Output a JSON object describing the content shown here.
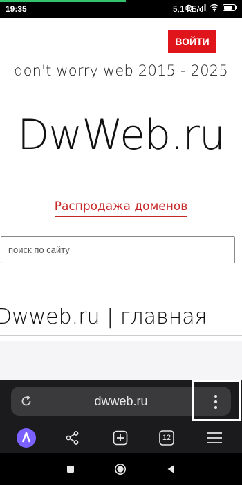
{
  "status_bar": {
    "time": "19:35",
    "network_speed": "5,1 КБ/с",
    "icons": [
      "alarm-icon",
      "signal-icon",
      "wifi-icon",
      "battery-icon"
    ],
    "page_load_progress": 0.52
  },
  "header": {
    "login_label": "ВОЙТИ",
    "tagline": "don't worry web 2015 - 2025",
    "logo": "DwWeb.ru",
    "sale_link": "Распродажа доменов"
  },
  "search": {
    "placeholder": "поиск по сайту",
    "value": ""
  },
  "main": {
    "heading": "Dwweb.ru | главная"
  },
  "browser": {
    "url": "dwweb.ru",
    "tab_count": "12",
    "toolbar_icons": [
      "alice-assistant-icon",
      "share-icon",
      "new-tab-icon",
      "tabs-counter-icon",
      "menu-icon"
    ]
  },
  "nav_bar": {
    "icons": [
      "recent-apps-icon",
      "home-icon",
      "back-icon"
    ]
  },
  "colors": {
    "login_bg": "#e0141b",
    "sale_link": "#c62828",
    "browser_panel": "#1b1b1d",
    "omnibox": "#3a3a3d",
    "alice_purple": "#7b61ff",
    "progress": "#32c36c"
  }
}
